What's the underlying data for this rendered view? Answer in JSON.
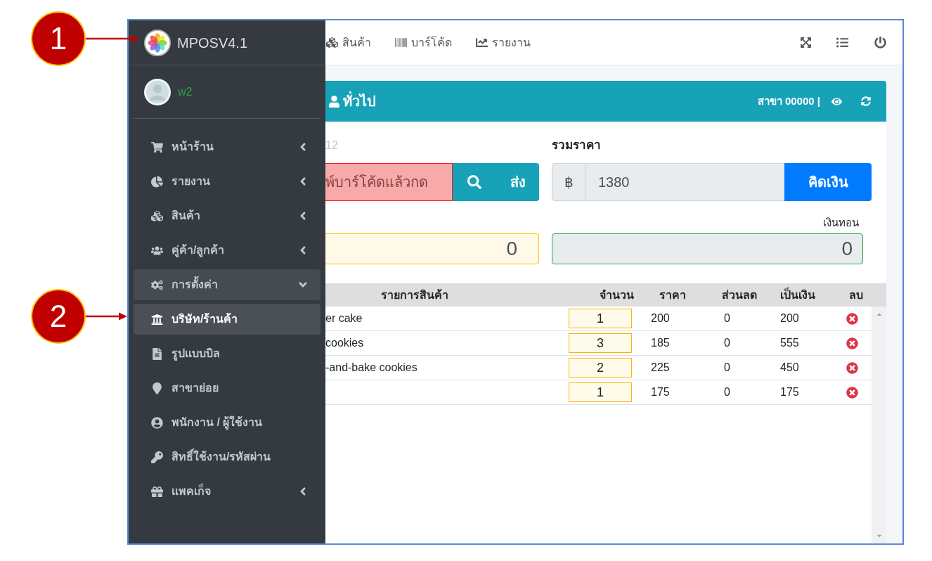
{
  "annotations": [
    {
      "label": "1"
    },
    {
      "label": "2"
    }
  ],
  "sidebar": {
    "brand": "MPOSV4.1",
    "user": "w2",
    "items": [
      {
        "label": "หน้าร้าน",
        "expanded": false,
        "selected": false
      },
      {
        "label": "รายงาน",
        "expanded": false,
        "selected": false
      },
      {
        "label": "สินค้า",
        "expanded": false,
        "selected": false
      },
      {
        "label": "คู่ค้า/ลูกค้า",
        "expanded": false,
        "selected": false
      },
      {
        "label": "การตั้งค่า",
        "expanded": true,
        "selected": false,
        "children": [
          {
            "label": "บริษัท/ร้านค้า",
            "selected": true
          },
          {
            "label": "รูปแบบบิล",
            "selected": false
          },
          {
            "label": "สาขาย่อย",
            "selected": false
          },
          {
            "label": "พนักงาน / ผู้ใช้งาน",
            "selected": false
          },
          {
            "label": "สิทธิ์ใช้งาน/รหัสผ่าน",
            "selected": false
          }
        ]
      },
      {
        "label": "แพคเก็จ",
        "expanded": false,
        "selected": false
      }
    ]
  },
  "navbar": {
    "links": [
      {
        "label": "สินค้า"
      },
      {
        "label": "บาร์โค้ด"
      },
      {
        "label": "รายงาน"
      }
    ]
  },
  "card": {
    "title": "ทั่วไป",
    "branch": "สาขา 00000 |"
  },
  "barcode": {
    "label": "12",
    "placeholder": "พ์บาร์โค้ดแล้วกด",
    "button": "ส่ง"
  },
  "total": {
    "label": "รวมราคา",
    "currency": "฿",
    "value": "1380",
    "button": "คิดเงิน"
  },
  "received": {
    "value": "0"
  },
  "change": {
    "label": "เงินทอน",
    "value": "0"
  },
  "table": {
    "columns": [
      "รายการสินค้า",
      "จำนวน",
      "ราคา",
      "ส่วนลด",
      "เป็นเงิน",
      "ลบ"
    ],
    "rows": [
      {
        "name": "er cake",
        "qty": "1",
        "price": "200",
        "discount": "0",
        "total": "200"
      },
      {
        "name": "cookies",
        "qty": "3",
        "price": "185",
        "discount": "0",
        "total": "555"
      },
      {
        "name": "-and-bake cookies",
        "qty": "2",
        "price": "225",
        "discount": "0",
        "total": "450"
      },
      {
        "qty": "1",
        "price": "175",
        "discount": "0",
        "total": "175"
      }
    ]
  }
}
